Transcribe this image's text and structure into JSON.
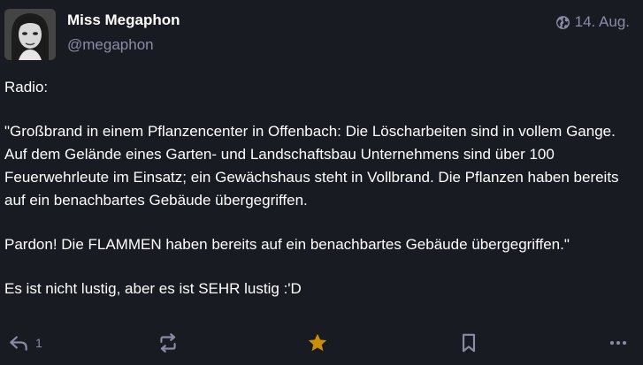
{
  "account": {
    "display_name": "Miss Megaphon",
    "handle": "@megaphon"
  },
  "meta": {
    "visibility_icon": "globe-icon",
    "date": "14. Aug."
  },
  "content": {
    "paragraphs": [
      "Radio:",
      "\"Großbrand in einem Pflanzencenter in Offenbach: Die Löscharbeiten sind in vollem Gange. Auf dem Gelände eines Garten- und Landschaftsbau Unternehmens sind über 100 Feuerwehrleute im Einsatz; ein Gewächshaus steht in Vollbrand. Die Pflanzen haben bereits auf ein benachbartes Gebäude übergegriffen.",
      "Pardon! Die FLAMMEN haben bereits auf ein benachbartes Gebäude übergegriffen.\"",
      "Es ist nicht lustig, aber es ist SEHR lustig :'D"
    ]
  },
  "actions": {
    "reply_count": "1",
    "reply_icon": "reply-icon",
    "boost_icon": "boost-icon",
    "favourite_icon": "star-icon",
    "bookmark_icon": "bookmark-icon",
    "more_icon": "more-icon",
    "favourite_color": "#ca8f04",
    "muted_color": "#8b8ba7"
  }
}
